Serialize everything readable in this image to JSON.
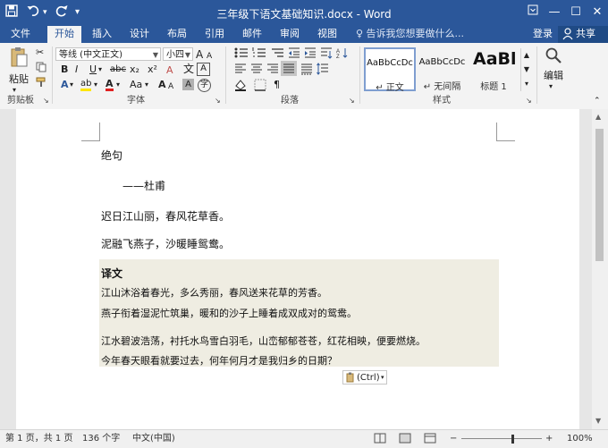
{
  "title_bar": {
    "title": "三年级下语文基础知识.docx - Word",
    "save_icon": "save-icon",
    "undo_icon": "undo-icon",
    "redo_icon": "redo-icon",
    "customize_icon": "customize-qat-icon"
  },
  "tabs": [
    {
      "label": "文件"
    },
    {
      "label": "开始"
    },
    {
      "label": "插入"
    },
    {
      "label": "设计"
    },
    {
      "label": "布局"
    },
    {
      "label": "引用"
    },
    {
      "label": "邮件"
    },
    {
      "label": "审阅"
    },
    {
      "label": "视图"
    }
  ],
  "tell_me": "♀ 告诉我您想要做什么...",
  "sign_in": "登录",
  "share": "共享",
  "ribbon": {
    "clipboard": {
      "paste": "粘贴",
      "label": "剪贴板"
    },
    "font": {
      "font_name": "等线 (中文正文)",
      "font_size": "小四",
      "label": "字体",
      "bold": "B",
      "italic": "I",
      "underline": "U",
      "strike": "abc",
      "sub": "x₂",
      "sup": "x²",
      "text_effects": "A",
      "highlight": "ab",
      "font_color": "A",
      "change_case": "Aa",
      "grow": "A",
      "shrink": "A",
      "phonetic": "文",
      "char_border": "A",
      "char_shading": "A",
      "enclose": "字",
      "clear": "A"
    },
    "paragraph": {
      "label": "段落"
    },
    "styles": {
      "label": "样式",
      "items": [
        {
          "sample": "AaBbCcDc",
          "name": "↵ 正文"
        },
        {
          "sample": "AaBbCcDc",
          "name": "↵ 无间隔"
        },
        {
          "sample": "AaBl",
          "name": "标题 1"
        }
      ]
    },
    "editing": {
      "label": "编辑"
    }
  },
  "document": {
    "paragraphs": [
      {
        "text": "绝句"
      },
      {
        "text": "——杜甫"
      },
      {
        "text": "迟日江山丽，春风花草香。"
      },
      {
        "text": "泥融飞燕子，沙暖睡鸳鸯。"
      },
      {
        "text": "译文"
      },
      {
        "text": "江山沐浴着春光，多么秀丽，春风送来花草的芳香。"
      },
      {
        "text": "燕子衔着湿泥忙筑巢，暖和的沙子上睡着成双成对的鸳鸯。"
      },
      {
        "text": "江水碧波浩荡，衬托水鸟雪白羽毛，山峦郁郁苍苍，红花相映，便要燃烧。"
      },
      {
        "text": "今年春天眼看就要过去，何年何月才是我归乡的日期？"
      }
    ],
    "paste_options": "(Ctrl)"
  },
  "status_bar": {
    "page": "第 1 页，共 1 页",
    "words": "136 个字",
    "language": "中文(中国)",
    "zoom": "100%"
  }
}
